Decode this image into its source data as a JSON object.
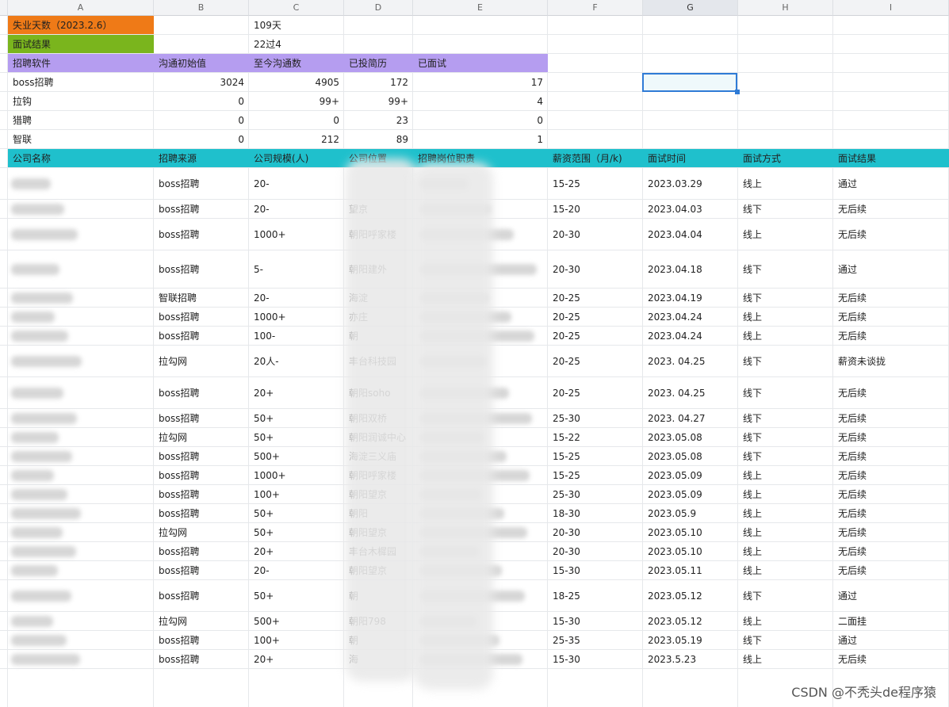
{
  "columns": [
    "A",
    "B",
    "C",
    "D",
    "E",
    "F",
    "G",
    "H",
    "I"
  ],
  "selected_column": "G",
  "summary": {
    "unemployed_label": "失业天数（2023.2.6）",
    "unemployed_value": "109天",
    "interview_label": "面试结果",
    "interview_value": "22过4"
  },
  "platform_header": [
    "招聘软件",
    "沟通初始值",
    "至今沟通数",
    "已投简历",
    "已面试"
  ],
  "platforms": [
    [
      "boss招聘",
      "3024",
      "4905",
      "172",
      "17"
    ],
    [
      "拉钩",
      "0",
      "99+",
      "99+",
      "4"
    ],
    [
      "猎聘",
      "0",
      "0",
      "23",
      "0"
    ],
    [
      "智联",
      "0",
      "212",
      "89",
      "1"
    ]
  ],
  "table_header": [
    "公司名称",
    "招聘来源",
    "公司规模(人)",
    "公司位置",
    "招聘岗位职责",
    "薪资范围（月/k)",
    "面试时间",
    "面试方式",
    "面试结果"
  ],
  "rows": [
    [
      "",
      "boss招聘",
      "20-",
      "",
      "",
      "15-25",
      "2023.03.29",
      "线上",
      "通过"
    ],
    [
      "",
      "boss招聘",
      "20-",
      "望京",
      "",
      "15-20",
      "2023.04.03",
      "线下",
      "无后续"
    ],
    [
      "",
      "boss招聘",
      "1000+",
      "朝阳呼家楼",
      "",
      "20-30",
      "2023.04.04",
      "线上",
      "无后续"
    ],
    [
      "",
      "boss招聘",
      "5-",
      "朝阳建外",
      "",
      "20-30",
      "2023.04.18",
      "线下",
      "通过"
    ],
    [
      "",
      "智联招聘",
      "20-",
      "海淀",
      "",
      "20-25",
      "2023.04.19",
      "线下",
      "无后续"
    ],
    [
      "",
      "boss招聘",
      "1000+",
      "亦庄",
      "",
      "20-25",
      "2023.04.24",
      "线上",
      "无后续"
    ],
    [
      "",
      "boss招聘",
      "100-",
      "朝",
      "",
      "20-25",
      "2023.04.24",
      "线上",
      "无后续"
    ],
    [
      "",
      "拉勾网",
      "20人-",
      "丰台科技园",
      "",
      "20-25",
      "2023. 04.25",
      "线下",
      "薪资未谈拢"
    ],
    [
      "",
      "boss招聘",
      "20+",
      "朝阳soho",
      "",
      "20-25",
      "2023. 04.25",
      "线下",
      "无后续"
    ],
    [
      "",
      "boss招聘",
      "50+",
      "朝阳双桥",
      "",
      "25-30",
      "2023. 04.27",
      "线下",
      "无后续"
    ],
    [
      "",
      "拉勾网",
      "50+",
      "朝阳润诚中心",
      "",
      "15-22",
      "2023.05.08",
      "线下",
      "无后续"
    ],
    [
      "",
      "boss招聘",
      "500+",
      "海淀三义庙",
      "",
      "15-25",
      "2023.05.08",
      "线下",
      "无后续"
    ],
    [
      "",
      "boss招聘",
      "1000+",
      "朝阳呼家楼",
      "",
      "15-25",
      "2023.05.09",
      "线上",
      "无后续"
    ],
    [
      "",
      "boss招聘",
      "100+",
      "朝阳望京",
      "",
      "25-30",
      "2023.05.09",
      "线上",
      "无后续"
    ],
    [
      "",
      "boss招聘",
      "50+",
      "朝阳",
      "",
      "18-30",
      "2023.05.9",
      "线上",
      "无后续"
    ],
    [
      "",
      "拉勾网",
      "50+",
      "朝阳望京",
      "",
      "20-30",
      "2023.05.10",
      "线上",
      "无后续"
    ],
    [
      "",
      "boss招聘",
      "20+",
      "丰台木樨园",
      "",
      "20-30",
      "2023.05.10",
      "线上",
      "无后续"
    ],
    [
      "",
      "boss招聘",
      "20-",
      "朝阳望京",
      "",
      "15-30",
      "2023.05.11",
      "线上",
      "无后续"
    ],
    [
      "",
      "boss招聘",
      "50+",
      "朝",
      "",
      "18-25",
      "2023.05.12",
      "线下",
      "通过"
    ],
    [
      "",
      "拉勾网",
      "500+",
      "朝阳798",
      "",
      "15-30",
      "2023.05.12",
      "线上",
      "二面挂"
    ],
    [
      "",
      "boss招聘",
      "100+",
      "朝",
      "",
      "25-35",
      "2023.05.19",
      "线下",
      "通过"
    ],
    [
      "",
      "boss招聘",
      "20+",
      "海",
      "",
      "15-30",
      "2023.5.23",
      "线上",
      "无后续"
    ]
  ],
  "watermark": "CSDN @不秃头de程序猿",
  "colors": {
    "orange": "#ef7a17",
    "green": "#7ab51d",
    "purple": "#b59df0",
    "teal": "#1fc0cc"
  }
}
